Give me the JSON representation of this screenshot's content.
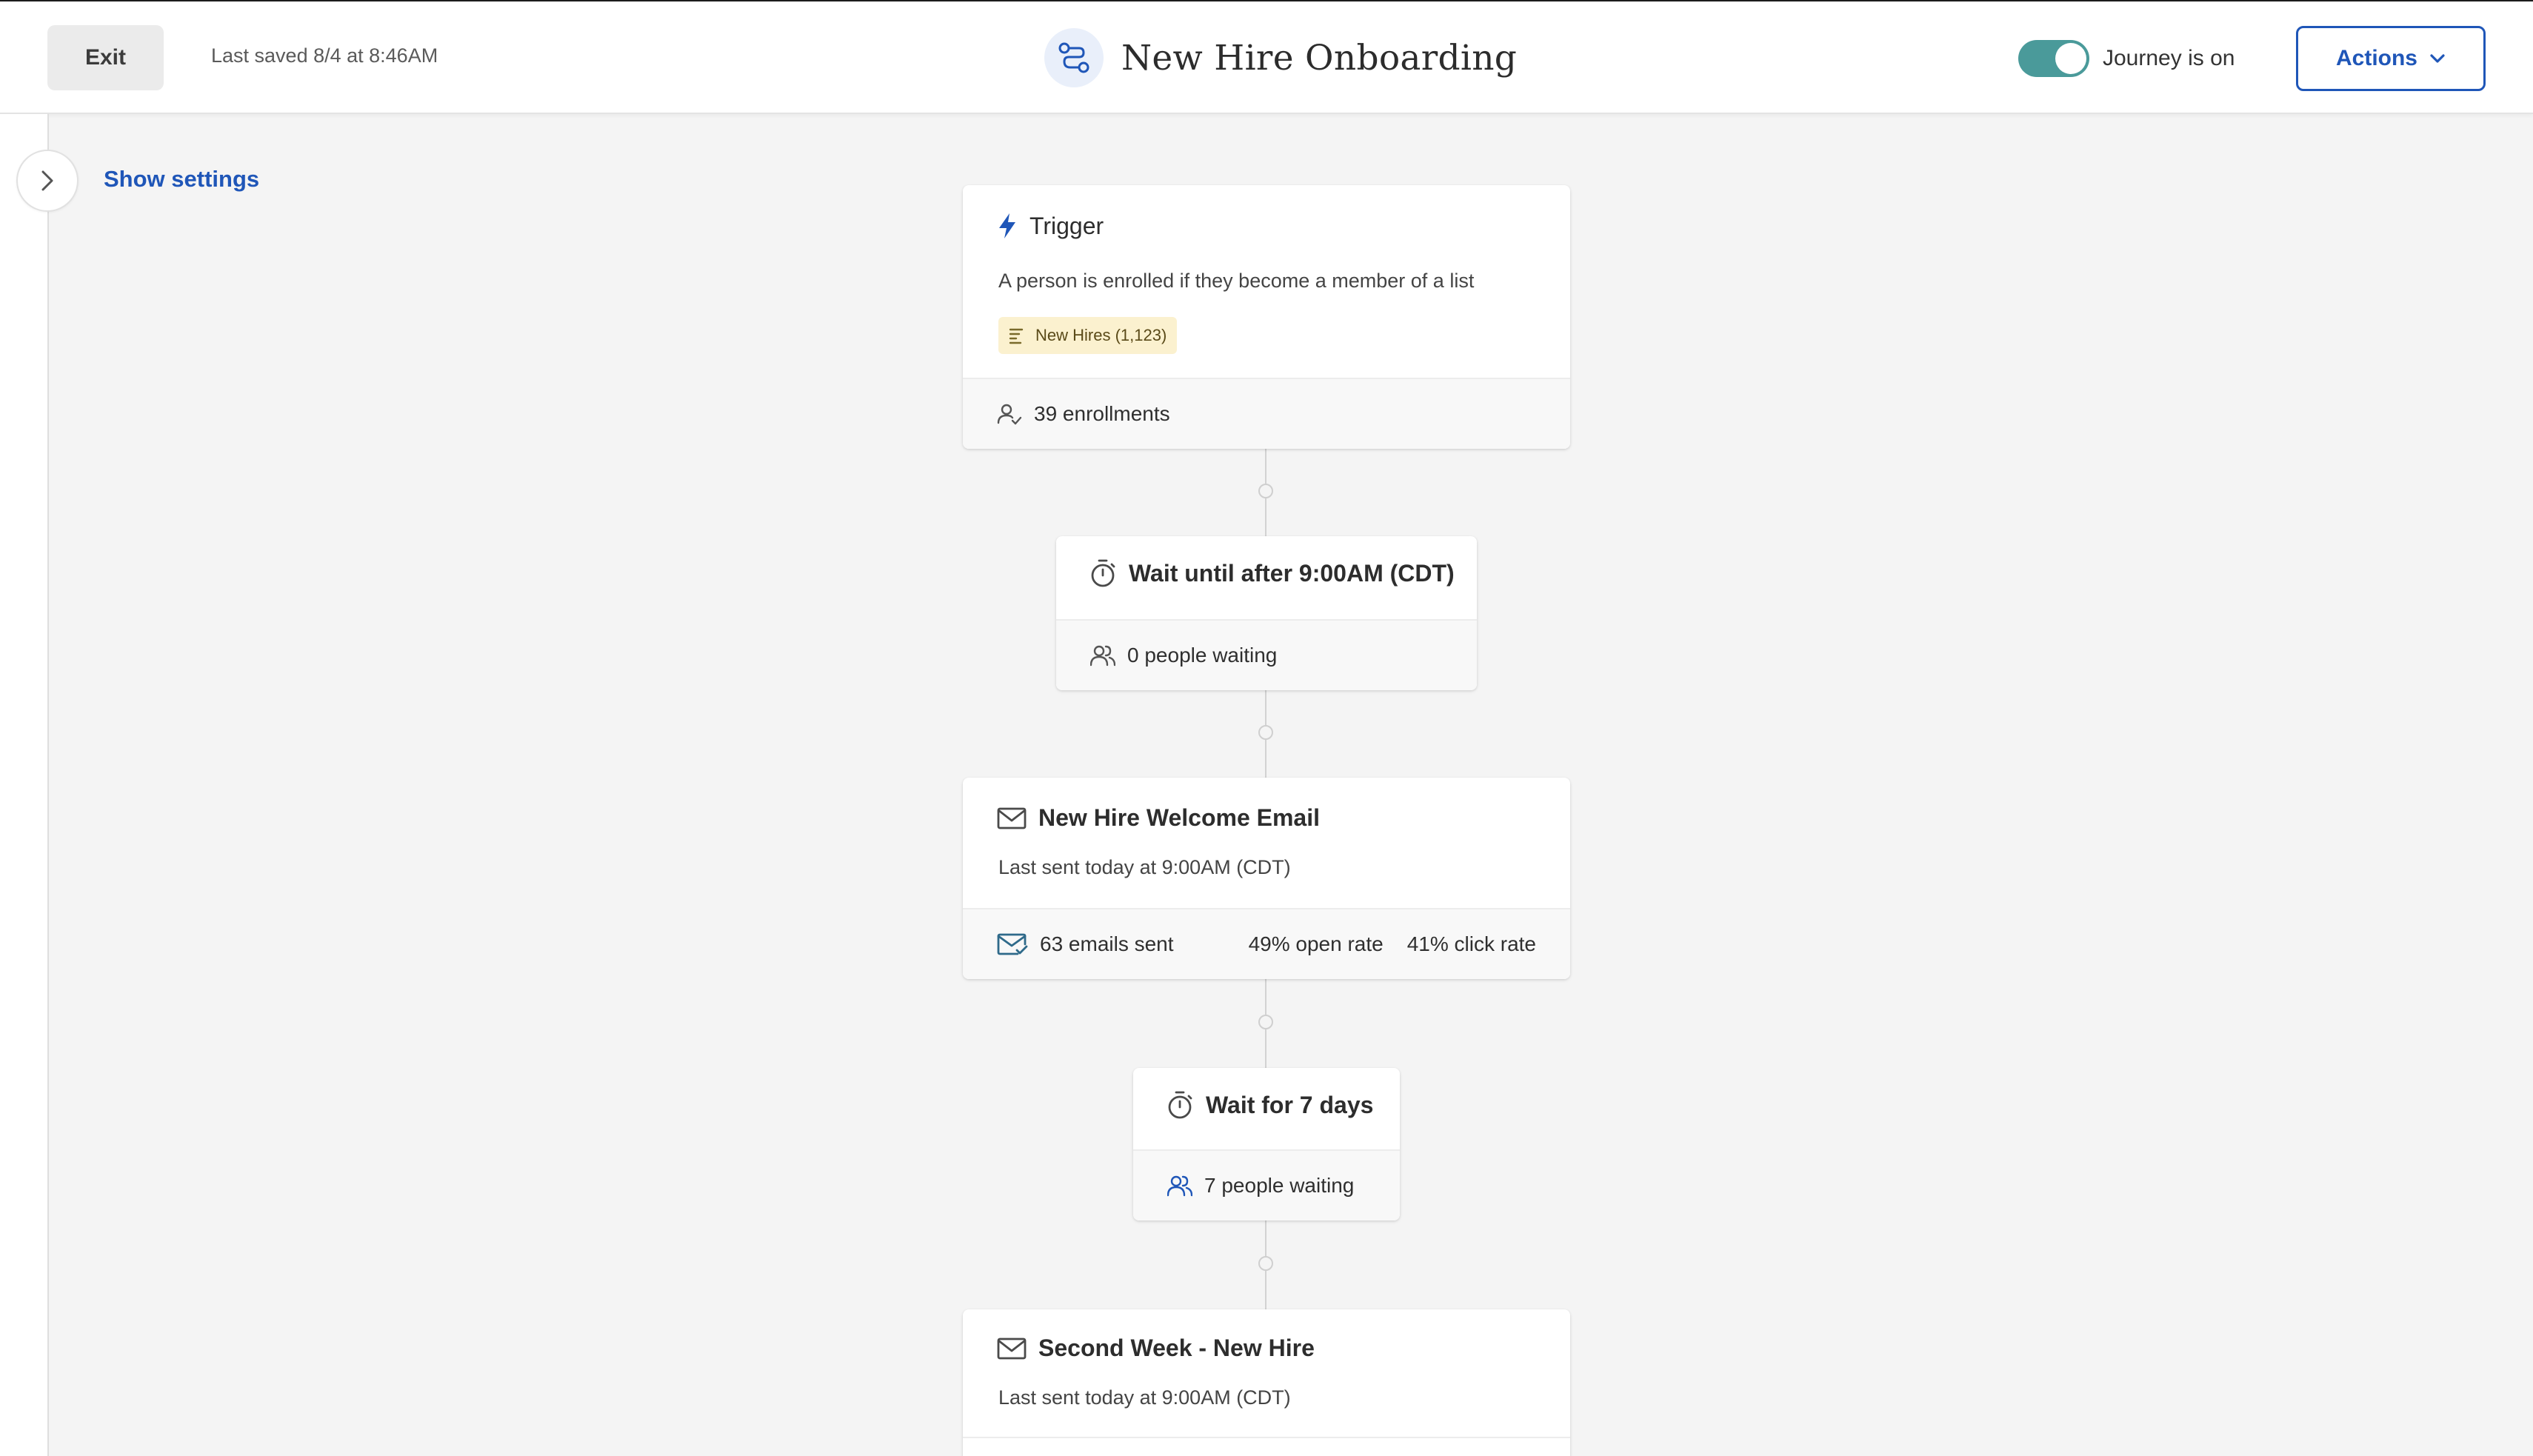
{
  "header": {
    "exit_label": "Exit",
    "last_saved": "Last saved 8/4 at 8:46AM",
    "title": "New Hire Onboarding",
    "toggle_label": "Journey is on",
    "toggle_on": true,
    "actions_label": "Actions"
  },
  "sidebar": {
    "show_settings": "Show settings"
  },
  "flow": {
    "trigger": {
      "title": "Trigger",
      "description": "A person is enrolled if they become a member of a list",
      "list_tag": "New Hires (1,123)",
      "enrollments": "39 enrollments"
    },
    "wait1": {
      "title": "Wait until after 9:00AM (CDT)",
      "status": "0 people waiting"
    },
    "email1": {
      "title": "New Hire Welcome Email",
      "last_sent": "Last sent today at 9:00AM (CDT)",
      "emails_sent": "63 emails sent",
      "open_rate": "49% open rate",
      "click_rate": "41% click rate"
    },
    "wait2": {
      "title": "Wait for 7 days",
      "status": "7 people waiting"
    },
    "email2": {
      "title": "Second Week - New Hire",
      "last_sent": "Last sent today at 9:00AM (CDT)"
    }
  },
  "colors": {
    "accent_blue": "#1f56b8",
    "toggle_on": "#4a9a9a",
    "tag_bg": "#fbf1cf",
    "canvas_bg": "#f4f4f4"
  },
  "icons": {
    "title": "journey-path-icon",
    "trigger": "lightning-icon",
    "wait": "stopwatch-icon",
    "email": "envelope-icon",
    "list": "list-icon",
    "enrollments": "person-check-icon",
    "people": "people-icon",
    "email_sent": "envelope-check-icon"
  }
}
